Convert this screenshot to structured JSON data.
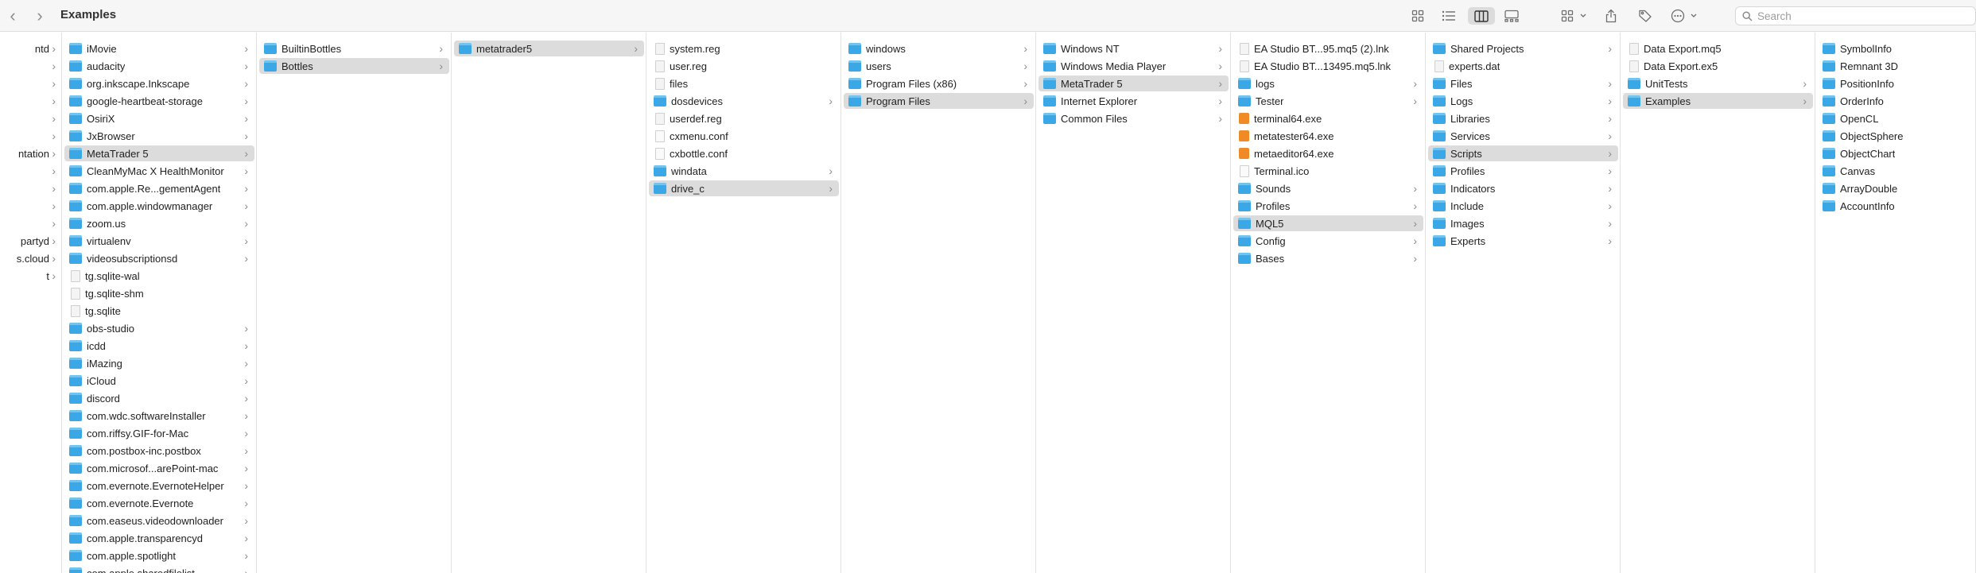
{
  "window": {
    "title": "Examples"
  },
  "toolbar": {
    "back_icon": "chevron-left-icon",
    "forward_icon": "chevron-right-icon",
    "search_placeholder": "Search"
  },
  "columns": [
    {
      "items": [
        {
          "label": "ntd",
          "type": "folder",
          "chev": true
        },
        {
          "label": "",
          "type": "folder",
          "chev": true
        },
        {
          "label": "",
          "type": "folder",
          "chev": true
        },
        {
          "label": "",
          "type": "folder",
          "chev": true
        },
        {
          "label": "",
          "type": "folder",
          "chev": true
        },
        {
          "label": "",
          "type": "folder",
          "chev": true
        },
        {
          "label": "ntation",
          "type": "folder",
          "chev": true
        },
        {
          "label": "",
          "type": "folder",
          "chev": true
        },
        {
          "label": "",
          "type": "folder",
          "chev": true
        },
        {
          "label": "",
          "type": "folder",
          "chev": true
        },
        {
          "label": "",
          "type": "folder",
          "chev": true
        },
        {
          "label": "partyd",
          "type": "folder",
          "chev": true
        },
        {
          "label": "s.cloud",
          "type": "folder",
          "chev": true
        },
        {
          "label": "t",
          "type": "folder",
          "chev": true
        }
      ]
    },
    {
      "items": [
        {
          "label": "iMovie",
          "type": "folder",
          "chev": true
        },
        {
          "label": "audacity",
          "type": "folder",
          "chev": true
        },
        {
          "label": "org.inkscape.Inkscape",
          "type": "folder",
          "chev": true
        },
        {
          "label": "google-heartbeat-storage",
          "type": "folder",
          "chev": true
        },
        {
          "label": "OsiriX",
          "type": "folder",
          "chev": true
        },
        {
          "label": "JxBrowser",
          "type": "folder",
          "chev": true
        },
        {
          "label": "MetaTrader 5",
          "type": "folder",
          "chev": true,
          "selected": true
        },
        {
          "label": "CleanMyMac X HealthMonitor",
          "type": "folder",
          "chev": true
        },
        {
          "label": "com.apple.Re...gementAgent",
          "type": "folder",
          "chev": true
        },
        {
          "label": "com.apple.windowmanager",
          "type": "folder",
          "chev": true
        },
        {
          "label": "zoom.us",
          "type": "folder",
          "chev": true
        },
        {
          "label": "virtualenv",
          "type": "folder",
          "chev": true
        },
        {
          "label": "videosubscriptionsd",
          "type": "folder",
          "chev": true
        },
        {
          "label": "tg.sqlite-wal",
          "type": "doc",
          "chev": false
        },
        {
          "label": "tg.sqlite-shm",
          "type": "doc",
          "chev": false
        },
        {
          "label": "tg.sqlite",
          "type": "doc",
          "chev": false
        },
        {
          "label": "obs-studio",
          "type": "folder",
          "chev": true
        },
        {
          "label": "icdd",
          "type": "folder",
          "chev": true
        },
        {
          "label": "iMazing",
          "type": "folder",
          "chev": true
        },
        {
          "label": "iCloud",
          "type": "folder",
          "chev": true
        },
        {
          "label": "discord",
          "type": "folder",
          "chev": true
        },
        {
          "label": "com.wdc.softwareInstaller",
          "type": "folder",
          "chev": true
        },
        {
          "label": "com.riffsy.GIF-for-Mac",
          "type": "folder",
          "chev": true
        },
        {
          "label": "com.postbox-inc.postbox",
          "type": "folder",
          "chev": true
        },
        {
          "label": "com.microsof...arePoint-mac",
          "type": "folder",
          "chev": true
        },
        {
          "label": "com.evernote.EvernoteHelper",
          "type": "folder",
          "chev": true
        },
        {
          "label": "com.evernote.Evernote",
          "type": "folder",
          "chev": true
        },
        {
          "label": "com.easeus.videodownloader",
          "type": "folder",
          "chev": true
        },
        {
          "label": "com.apple.transparencyd",
          "type": "folder",
          "chev": true
        },
        {
          "label": "com.apple.spotlight",
          "type": "folder",
          "chev": true
        },
        {
          "label": "com.apple.sharedfilelist",
          "type": "folder",
          "chev": true
        }
      ]
    },
    {
      "items": [
        {
          "label": "BuiltinBottles",
          "type": "folder",
          "chev": true
        },
        {
          "label": "Bottles",
          "type": "folder",
          "chev": true,
          "selected": true
        }
      ]
    },
    {
      "items": [
        {
          "label": "metatrader5",
          "type": "folder",
          "chev": true,
          "selected": true
        }
      ]
    },
    {
      "items": [
        {
          "label": "system.reg",
          "type": "doc",
          "chev": false
        },
        {
          "label": "user.reg",
          "type": "doc",
          "chev": false
        },
        {
          "label": "files",
          "type": "doc",
          "chev": false
        },
        {
          "label": "dosdevices",
          "type": "folder",
          "chev": true
        },
        {
          "label": "userdef.reg",
          "type": "doc",
          "chev": false
        },
        {
          "label": "cxmenu.conf",
          "type": "conf",
          "chev": false
        },
        {
          "label": "cxbottle.conf",
          "type": "conf",
          "chev": false
        },
        {
          "label": "windata",
          "type": "folder",
          "chev": true
        },
        {
          "label": "drive_c",
          "type": "folder",
          "chev": true,
          "selected": true
        }
      ]
    },
    {
      "items": [
        {
          "label": "windows",
          "type": "folder",
          "chev": true
        },
        {
          "label": "users",
          "type": "folder",
          "chev": true
        },
        {
          "label": "Program Files (x86)",
          "type": "folder",
          "chev": true
        },
        {
          "label": "Program Files",
          "type": "folder",
          "chev": true,
          "selected": true
        }
      ]
    },
    {
      "items": [
        {
          "label": "Windows NT",
          "type": "folder",
          "chev": true
        },
        {
          "label": "Windows Media Player",
          "type": "folder",
          "chev": true
        },
        {
          "label": "MetaTrader 5",
          "type": "folder",
          "chev": true,
          "selected": true
        },
        {
          "label": "Internet Explorer",
          "type": "folder",
          "chev": true
        },
        {
          "label": "Common Files",
          "type": "folder",
          "chev": true
        }
      ]
    },
    {
      "items": [
        {
          "label": "EA Studio BT...95.mq5 (2).lnk",
          "type": "doc",
          "chev": false
        },
        {
          "label": "EA Studio BT...13495.mq5.lnk",
          "type": "doc",
          "chev": false
        },
        {
          "label": "logs",
          "type": "folder",
          "chev": true
        },
        {
          "label": "Tester",
          "type": "folder",
          "chev": true
        },
        {
          "label": "terminal64.exe",
          "type": "exe",
          "chev": false
        },
        {
          "label": "metatester64.exe",
          "type": "exe",
          "chev": false
        },
        {
          "label": "metaeditor64.exe",
          "type": "exe",
          "chev": false
        },
        {
          "label": "Terminal.ico",
          "type": "conf",
          "chev": false
        },
        {
          "label": "Sounds",
          "type": "folder",
          "chev": true
        },
        {
          "label": "Profiles",
          "type": "folder",
          "chev": true
        },
        {
          "label": "MQL5",
          "type": "folder",
          "chev": true,
          "selected": true
        },
        {
          "label": "Config",
          "type": "folder",
          "chev": true
        },
        {
          "label": "Bases",
          "type": "folder",
          "chev": true
        }
      ]
    },
    {
      "items": [
        {
          "label": "Shared Projects",
          "type": "folder",
          "chev": true
        },
        {
          "label": "experts.dat",
          "type": "doc",
          "chev": false
        },
        {
          "label": "Files",
          "type": "folder",
          "chev": true
        },
        {
          "label": "Logs",
          "type": "folder",
          "chev": true
        },
        {
          "label": "Libraries",
          "type": "folder",
          "chev": true
        },
        {
          "label": "Services",
          "type": "folder",
          "chev": true
        },
        {
          "label": "Scripts",
          "type": "folder",
          "chev": true,
          "selected": true
        },
        {
          "label": "Profiles",
          "type": "folder",
          "chev": true
        },
        {
          "label": "Indicators",
          "type": "folder",
          "chev": true
        },
        {
          "label": "Include",
          "type": "folder",
          "chev": true
        },
        {
          "label": "Images",
          "type": "folder",
          "chev": true
        },
        {
          "label": "Experts",
          "type": "folder",
          "chev": true
        }
      ]
    },
    {
      "items": [
        {
          "label": "Data Export.mq5",
          "type": "doc",
          "chev": false
        },
        {
          "label": "Data Export.ex5",
          "type": "doc",
          "chev": false
        },
        {
          "label": "UnitTests",
          "type": "folder",
          "chev": true
        },
        {
          "label": "Examples",
          "type": "folder",
          "chev": true,
          "selected": true
        }
      ]
    },
    {
      "items": [
        {
          "label": "SymbolInfo",
          "type": "folder",
          "chev": false
        },
        {
          "label": "Remnant 3D",
          "type": "folder",
          "chev": false
        },
        {
          "label": "PositionInfo",
          "type": "folder",
          "chev": false
        },
        {
          "label": "OrderInfo",
          "type": "folder",
          "chev": false
        },
        {
          "label": "OpenCL",
          "type": "folder",
          "chev": false
        },
        {
          "label": "ObjectSphere",
          "type": "folder",
          "chev": false
        },
        {
          "label": "ObjectChart",
          "type": "folder",
          "chev": false
        },
        {
          "label": "Canvas",
          "type": "folder",
          "chev": false
        },
        {
          "label": "ArrayDouble",
          "type": "folder",
          "chev": false
        },
        {
          "label": "AccountInfo",
          "type": "folder",
          "chev": false
        }
      ]
    }
  ]
}
